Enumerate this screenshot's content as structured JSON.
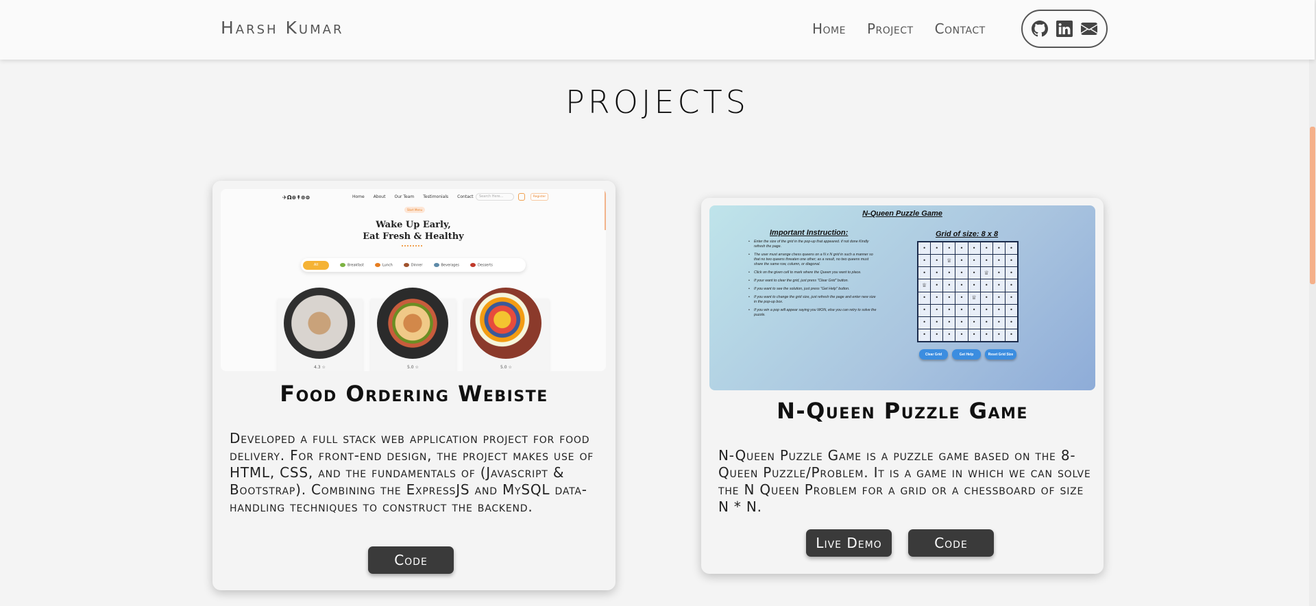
{
  "header": {
    "brand": "Harsh Kumar",
    "nav": [
      "Home",
      "Project",
      "Contact"
    ],
    "social_icons": [
      "github-icon",
      "linkedin-icon",
      "envelope-icon"
    ]
  },
  "section_title": "PROJECTS",
  "projects": [
    {
      "title": "Food Ordering Webiste",
      "description": "Developed a full stack web application project for food delivery. For front-end design, the project makes use of HTML, CSS, and the fundamentals of (Javascript & Bootstrap). Combining the ExpressJS and MySQL data-handling techniques to construct the backend.",
      "buttons": [
        "Code"
      ],
      "preview": {
        "logo": "✈Ω⊕↟⊛⊜",
        "nav": [
          "Home",
          "About",
          "Our Team",
          "Testimonials",
          "Contact"
        ],
        "search_placeholder": "Search Here...",
        "register_label": "Register",
        "pill": "Start Menu",
        "headline_1": "Wake Up Early,",
        "headline_2": "Eat Fresh & Healthy",
        "categories": [
          "All",
          "Breakfast",
          "Lunch",
          "Dinner",
          "Beverages",
          "Desserts"
        ],
        "ratings": [
          "4.3 ☆",
          "5.0 ☆",
          "5.0 ☆"
        ]
      }
    },
    {
      "title": "N-Queen Puzzle Game",
      "description": "N-Queen Puzzle Game is a puzzle game based on the 8-Queen Puzzle/Problem. It is a game in which we can solve the N Queen Problem for a grid or a chessboard of size N * N.",
      "buttons": [
        "Live Demo",
        "Code"
      ],
      "preview": {
        "title": "N-Queen Puzzle Game",
        "instructions_heading": "Important Instruction:",
        "instructions": [
          "Enter the size of the grid in the pop-up that appeared. if not done Kindly refresh the page.",
          "The user must arrange chess queens on a N x N grid in such a manner so that no two queens threaten one other; as a result, no two queens must share the same row, column, or diagonal.",
          "Click on the given cell to mark where the Queen you want to place.",
          "If your want to clear the grid, just press \"Clear Grid\" button.",
          "If you want to see the solution, just press \"Get Help\" button.",
          "If you want to change the grid size, just refresh the page and enter new size in the pop-up box.",
          "If you win a pop will appear saying you WON, else you can retry to solve the puzzle."
        ],
        "grid_heading": "Grid of size: 8 x 8",
        "queen_symbol": "♕",
        "buttons": [
          "Clear Grid",
          "Get Help",
          "Reset Grid Size"
        ]
      }
    }
  ]
}
